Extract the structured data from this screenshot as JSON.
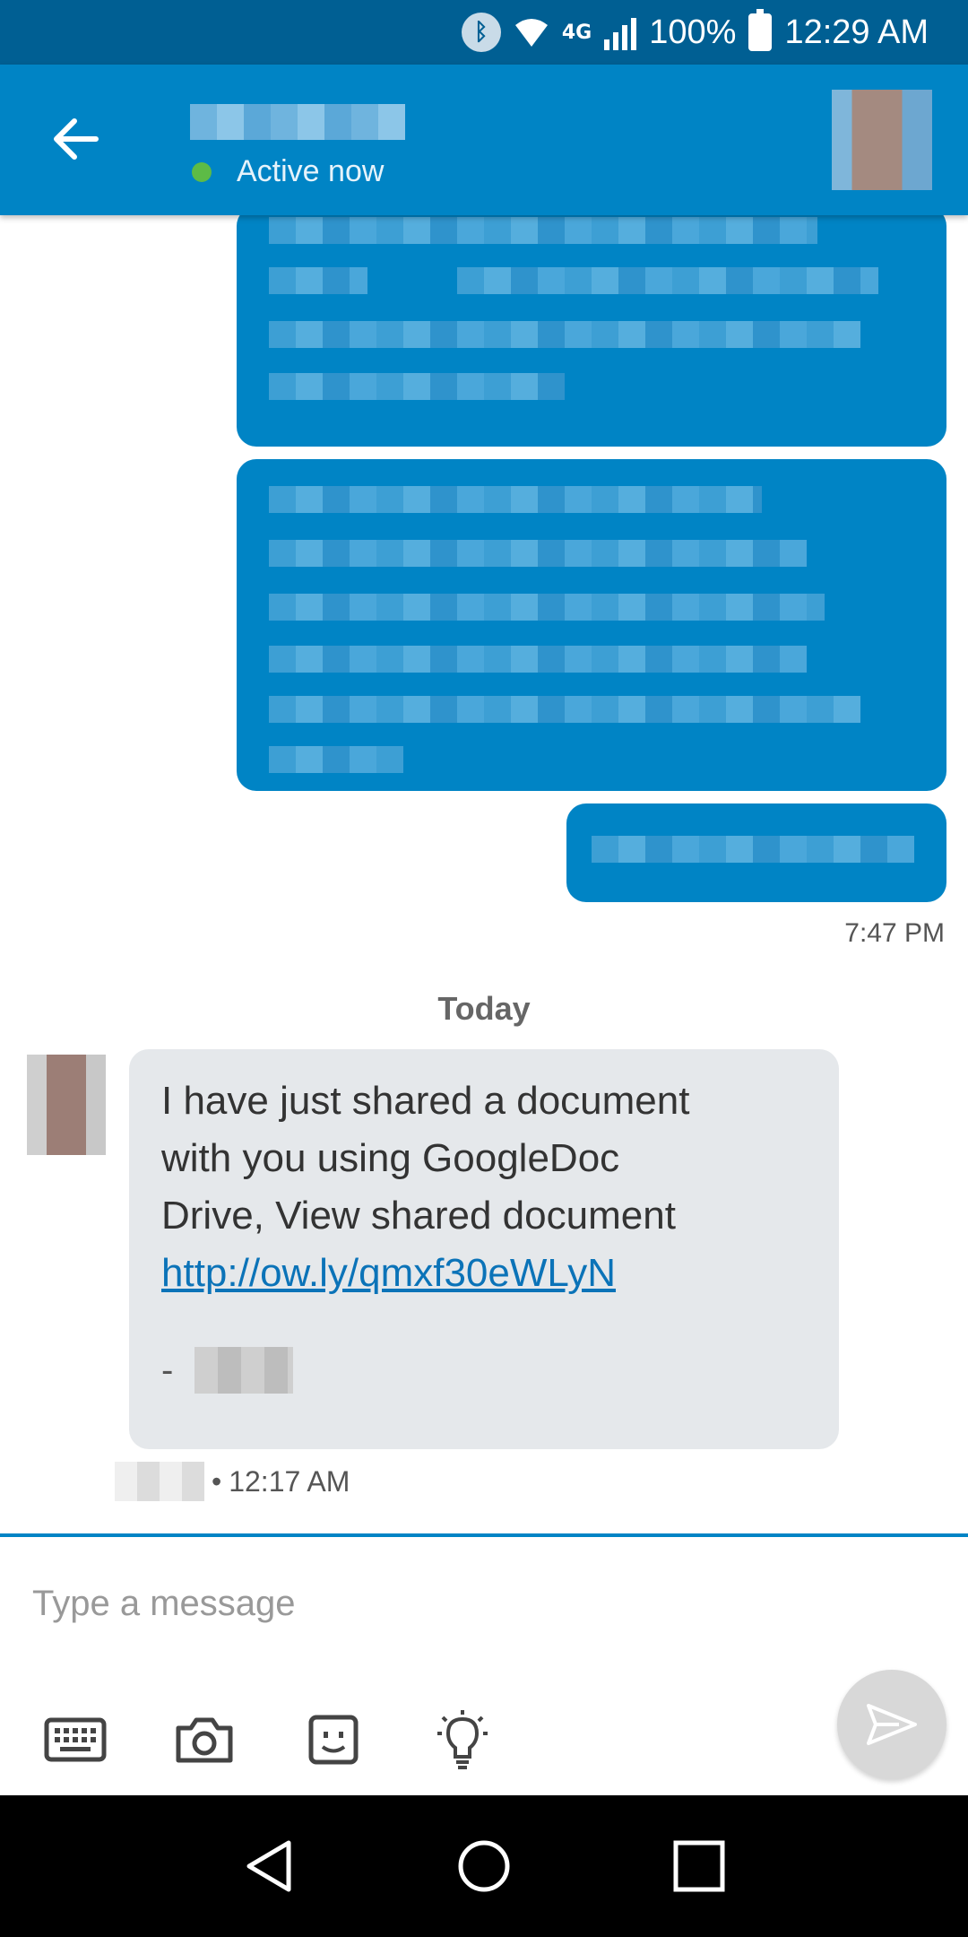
{
  "status_bar": {
    "bluetooth_icon": "bluetooth-icon",
    "network": "4G",
    "battery": "100%",
    "time": "12:29 AM"
  },
  "header": {
    "contact_name": "",
    "status": "Active now",
    "status_color": "#5dbb46",
    "accent": "#0084c5"
  },
  "conversation": {
    "outgoing_time": "7:47 PM",
    "day_label": "Today",
    "incoming": {
      "text_lines": [
        "I have just shared a document",
        "with you using GoogleDoc",
        "Drive, View shared document"
      ],
      "link": "http://ow.ly/qmxf30eWLyN",
      "signoff_dash": "-",
      "time": "12:17 AM",
      "separator": "•"
    }
  },
  "composer": {
    "placeholder": "Type a message",
    "tools": [
      "keyboard-icon",
      "camera-icon",
      "emoji-icon",
      "lightbulb-icon"
    ],
    "send_icon": "send-icon"
  },
  "nav": [
    "back-triangle-icon",
    "home-circle-icon",
    "recents-square-icon"
  ]
}
